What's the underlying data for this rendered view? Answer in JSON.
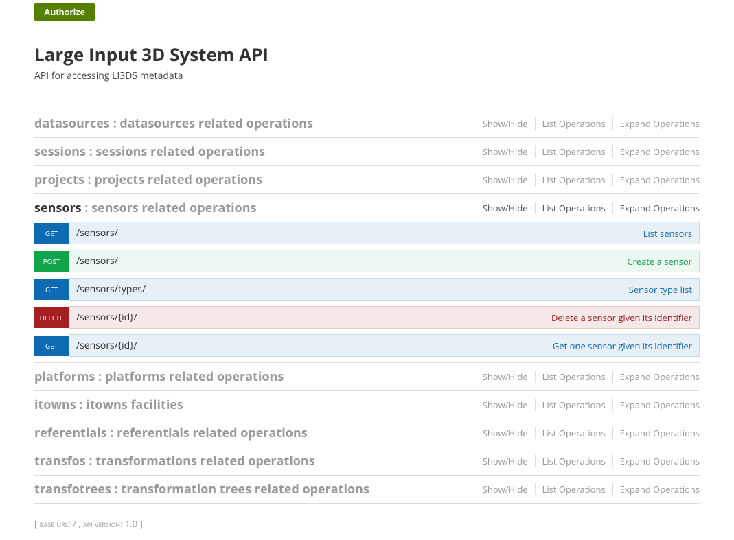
{
  "authorize_label": "Authorize",
  "api_title": "Large Input 3D System API",
  "api_description": "API for accessing LI3DS metadata",
  "controls": {
    "show_hide": "Show/Hide",
    "list_ops": "List Operations",
    "expand_ops": "Expand Operations"
  },
  "sections": [
    {
      "tag": "datasources",
      "desc": " : datasources related operations",
      "active": false,
      "ops": []
    },
    {
      "tag": "sessions",
      "desc": " : sessions related operations",
      "active": false,
      "ops": []
    },
    {
      "tag": "projects",
      "desc": " : projects related operations",
      "active": false,
      "ops": []
    },
    {
      "tag": "sensors",
      "desc": " : sensors related operations",
      "active": true,
      "ops": [
        {
          "method": "get",
          "path": "/sensors/",
          "summary": "List sensors"
        },
        {
          "method": "post",
          "path": "/sensors/",
          "summary": "Create a sensor"
        },
        {
          "method": "get",
          "path": "/sensors/types/",
          "summary": "Sensor type list"
        },
        {
          "method": "delete",
          "path": "/sensors/{id}/",
          "summary": "Delete a sensor given its identifier"
        },
        {
          "method": "get",
          "path": "/sensors/{id}/",
          "summary": "Get one sensor given its identifier"
        }
      ]
    },
    {
      "tag": "platforms",
      "desc": " : platforms related operations",
      "active": false,
      "ops": []
    },
    {
      "tag": "itowns",
      "desc": " : itowns facilities",
      "active": false,
      "ops": []
    },
    {
      "tag": "referentials",
      "desc": " : referentials related operations",
      "active": false,
      "ops": []
    },
    {
      "tag": "transfos",
      "desc": " : transformations related operations",
      "active": false,
      "ops": []
    },
    {
      "tag": "transfotrees",
      "desc": " : transformation trees related operations",
      "active": false,
      "ops": []
    }
  ],
  "footer": {
    "base_url_label": "base url",
    "base_url_value": "/",
    "api_version_label": "api version",
    "api_version_value": "1.0"
  }
}
